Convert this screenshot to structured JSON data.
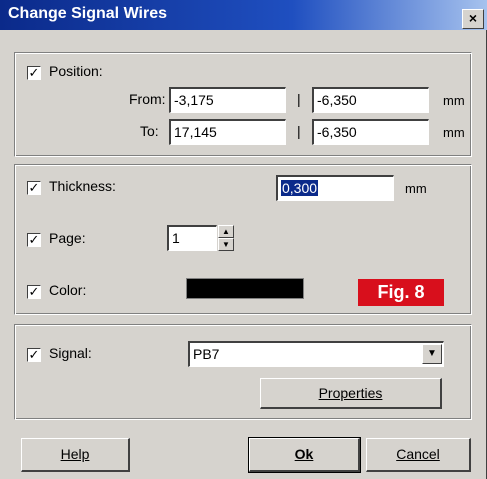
{
  "window": {
    "title": "Change Signal Wires",
    "close_glyph": "×"
  },
  "position": {
    "label": "Position:",
    "checked": true,
    "from_label": "From:",
    "to_label": "To:",
    "separator": "|",
    "from_x": "-3,175",
    "from_y": "-6,350",
    "to_x": "17,145",
    "to_y": "-6,350",
    "unit": "mm"
  },
  "thickness": {
    "label": "Thickness:",
    "checked": true,
    "value": "0,300",
    "unit": "mm"
  },
  "page": {
    "label": "Page:",
    "checked": true,
    "value": "1"
  },
  "color": {
    "label": "Color:",
    "checked": true,
    "swatch": "#000000"
  },
  "figure_badge": "Fig. 8",
  "signal": {
    "label": "Signal:",
    "checked": true,
    "value": "PB7",
    "properties_label": "Properties"
  },
  "buttons": {
    "help": "Help",
    "ok": "Ok",
    "cancel": "Cancel"
  },
  "colors": {
    "title_bar": "#0b2a8a",
    "dialog_bg": "#d6d3ce",
    "badge": "#d80f1c"
  }
}
